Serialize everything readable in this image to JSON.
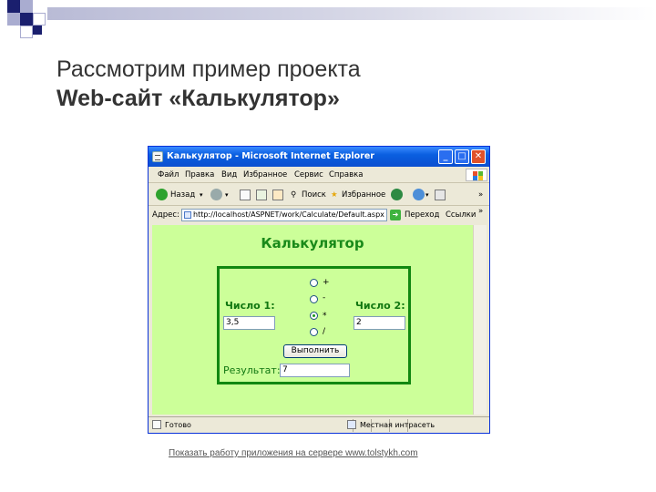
{
  "slide": {
    "title_line1": "Рассмотрим пример проекта",
    "title_line2": "Web-сайт «Калькулятор»",
    "footer_link": "Показать работу приложения на сервере www.tolstykh.com"
  },
  "browser": {
    "window_title": "Калькулятор - Microsoft Internet Explorer",
    "window_buttons": {
      "minimize": "_",
      "maximize": "□",
      "close": "✕"
    },
    "menu": [
      "Файл",
      "Правка",
      "Вид",
      "Избранное",
      "Сервис",
      "Справка"
    ],
    "toolbar": {
      "back": "Назад",
      "search": "Поиск",
      "favorites": "Избранное",
      "overflow": "»"
    },
    "address": {
      "label": "Адрес:",
      "url": "http://localhost/ASPNET/work/Calculate/Default.aspx",
      "go_label": "Переход",
      "links_label": "Ссылки",
      "overflow": "»"
    },
    "status": {
      "text": "Готово",
      "zone": "Местная интрасеть"
    }
  },
  "page": {
    "heading": "Калькулятор",
    "number1_label": "Число 1:",
    "number1_value": "3,5",
    "number2_label": "Число 2:",
    "number2_value": "2",
    "operations": [
      {
        "symbol": "+",
        "checked": false
      },
      {
        "symbol": "-",
        "checked": false
      },
      {
        "symbol": "*",
        "checked": true
      },
      {
        "symbol": "/",
        "checked": false
      }
    ],
    "run_button": "Выполнить",
    "result_label": "Результат:",
    "result_value": "7"
  },
  "colors": {
    "page_background": "#ccff99",
    "accent_green": "#118811",
    "title_bar_blue": "#0a5fe0",
    "slide_text": "#333333"
  }
}
